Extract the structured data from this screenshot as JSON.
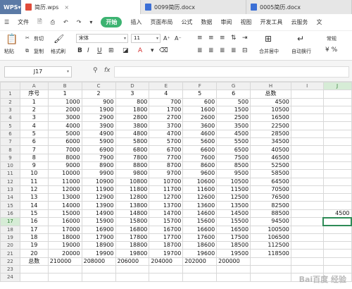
{
  "titlebar": {
    "logo": "WPS",
    "tabs": [
      {
        "label": "简历.wps",
        "active": true,
        "color": "#e04b3a"
      },
      {
        "label": "0099简历.docx",
        "active": false,
        "color": "#3b6fd6"
      },
      {
        "label": "0005简历.docx",
        "active": false,
        "color": "#3b6fd6"
      }
    ]
  },
  "menu": {
    "file": "文件",
    "start": "开始",
    "items": [
      "插入",
      "页面布局",
      "公式",
      "数据",
      "审阅",
      "视图",
      "开发工具",
      "云服务",
      "文"
    ]
  },
  "ribbon": {
    "paste": "粘贴",
    "cut": "剪切",
    "copy": "复制",
    "format_painter": "格式刷",
    "font_name": "宋体",
    "font_size": "11",
    "merge_center": "合并居中",
    "auto_wrap": "自动换行",
    "number_format": "常规"
  },
  "formula": {
    "cell_ref": "J17",
    "fx_label": "fx",
    "value": ""
  },
  "sheet": {
    "columns": [
      "A",
      "B",
      "C",
      "D",
      "E",
      "F",
      "G",
      "H",
      "I",
      "J"
    ],
    "rows": [
      {
        "n": "1",
        "cells": [
          "序号",
          "1",
          "2",
          "3",
          "4",
          "5",
          "6",
          "总数",
          "",
          ""
        ]
      },
      {
        "n": "2",
        "cells": [
          "1",
          "1000",
          "900",
          "800",
          "700",
          "600",
          "500",
          "4500",
          "",
          ""
        ]
      },
      {
        "n": "3",
        "cells": [
          "2",
          "2000",
          "1900",
          "1800",
          "1700",
          "1600",
          "1500",
          "10500",
          "",
          ""
        ]
      },
      {
        "n": "4",
        "cells": [
          "3",
          "3000",
          "2900",
          "2800",
          "2700",
          "2600",
          "2500",
          "16500",
          "",
          ""
        ]
      },
      {
        "n": "5",
        "cells": [
          "4",
          "4000",
          "3900",
          "3800",
          "3700",
          "3600",
          "3500",
          "22500",
          "",
          ""
        ]
      },
      {
        "n": "6",
        "cells": [
          "5",
          "5000",
          "4900",
          "4800",
          "4700",
          "4600",
          "4500",
          "28500",
          "",
          ""
        ]
      },
      {
        "n": "7",
        "cells": [
          "6",
          "6000",
          "5900",
          "5800",
          "5700",
          "5600",
          "5500",
          "34500",
          "",
          ""
        ]
      },
      {
        "n": "8",
        "cells": [
          "7",
          "7000",
          "6900",
          "6800",
          "6700",
          "6600",
          "6500",
          "40500",
          "",
          ""
        ]
      },
      {
        "n": "9",
        "cells": [
          "8",
          "8000",
          "7900",
          "7800",
          "7700",
          "7600",
          "7500",
          "46500",
          "",
          ""
        ]
      },
      {
        "n": "10",
        "cells": [
          "9",
          "9000",
          "8900",
          "8800",
          "8700",
          "8600",
          "8500",
          "52500",
          "",
          ""
        ]
      },
      {
        "n": "11",
        "cells": [
          "10",
          "10000",
          "9900",
          "9800",
          "9700",
          "9600",
          "9500",
          "58500",
          "",
          ""
        ]
      },
      {
        "n": "12",
        "cells": [
          "11",
          "11000",
          "10900",
          "10800",
          "10700",
          "10600",
          "10500",
          "64500",
          "",
          ""
        ]
      },
      {
        "n": "13",
        "cells": [
          "12",
          "12000",
          "11900",
          "11800",
          "11700",
          "11600",
          "11500",
          "70500",
          "",
          ""
        ]
      },
      {
        "n": "14",
        "cells": [
          "13",
          "13000",
          "12900",
          "12800",
          "12700",
          "12600",
          "12500",
          "76500",
          "",
          ""
        ]
      },
      {
        "n": "15",
        "cells": [
          "14",
          "14000",
          "13900",
          "13800",
          "13700",
          "13600",
          "13500",
          "82500",
          "",
          ""
        ]
      },
      {
        "n": "16",
        "cells": [
          "15",
          "15000",
          "14900",
          "14800",
          "14700",
          "14600",
          "14500",
          "88500",
          "",
          "4500"
        ]
      },
      {
        "n": "17",
        "cells": [
          "16",
          "16000",
          "15900",
          "15800",
          "15700",
          "15600",
          "15500",
          "94500",
          "",
          ""
        ]
      },
      {
        "n": "18",
        "cells": [
          "17",
          "17000",
          "16900",
          "16800",
          "16700",
          "16600",
          "16500",
          "100500",
          "",
          ""
        ]
      },
      {
        "n": "19",
        "cells": [
          "18",
          "18000",
          "17900",
          "17800",
          "17700",
          "17600",
          "17500",
          "106500",
          "",
          ""
        ]
      },
      {
        "n": "20",
        "cells": [
          "19",
          "19000",
          "18900",
          "18800",
          "18700",
          "18600",
          "18500",
          "112500",
          "",
          ""
        ]
      },
      {
        "n": "21",
        "cells": [
          "20",
          "20000",
          "19900",
          "19800",
          "19700",
          "19600",
          "19500",
          "118500",
          "",
          ""
        ]
      },
      {
        "n": "22",
        "cells": [
          "总数",
          "210000",
          "208000",
          "206000",
          "204000",
          "202000",
          "200000",
          "",
          "",
          ""
        ]
      },
      {
        "n": "23",
        "cells": [
          "",
          "",
          "",
          "",
          "",
          "",
          "",
          "",
          "",
          ""
        ]
      },
      {
        "n": "24",
        "cells": [
          "",
          "",
          "",
          "",
          "",
          "",
          "",
          "",
          "",
          ""
        ]
      }
    ]
  },
  "colors": {
    "accent": "#3cb371",
    "selection": "#2e8b57"
  }
}
